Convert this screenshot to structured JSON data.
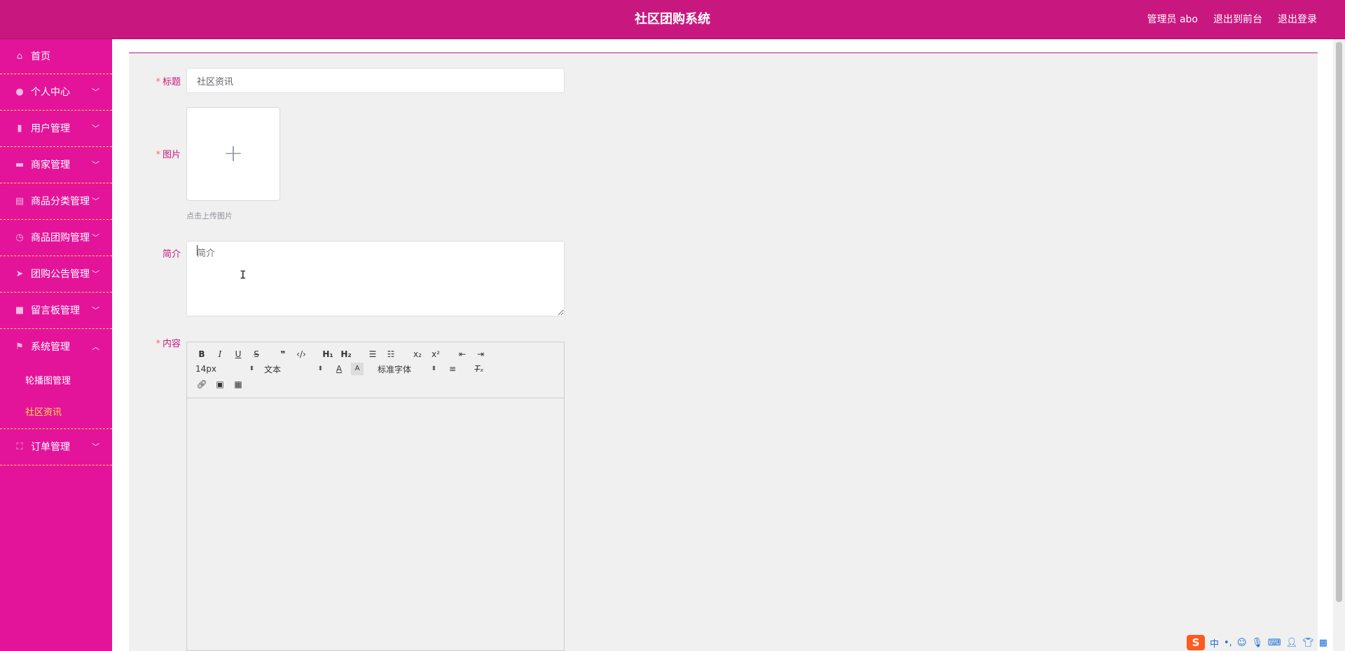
{
  "header": {
    "title": "社区团购系统",
    "user_role": "管理员",
    "username": "abo",
    "front_link": "退出到前台",
    "logout_link": "退出登录"
  },
  "sidebar": {
    "items": [
      {
        "label": "首页"
      },
      {
        "label": "个人中心"
      },
      {
        "label": "用户管理"
      },
      {
        "label": "商家管理"
      },
      {
        "label": "商品分类管理"
      },
      {
        "label": "商品团购管理"
      },
      {
        "label": "团购公告管理"
      },
      {
        "label": "留言板管理"
      },
      {
        "label": "系统管理",
        "children": [
          {
            "label": "轮播图管理"
          },
          {
            "label": "社区资讯",
            "active": true
          }
        ]
      },
      {
        "label": "订单管理"
      }
    ]
  },
  "form": {
    "title_label": "标题",
    "title_value": "社区资讯",
    "image_label": "图片",
    "upload_hint": "点击上传图片",
    "intro_label": "简介",
    "intro_placeholder": "简介",
    "content_label": "内容"
  },
  "editor": {
    "font_size": "14px",
    "text_type": "文本",
    "font_family": "标准字体"
  },
  "ime": {
    "mode": "中"
  },
  "colors": {
    "header_bg": "#c8187f",
    "sidebar_bg": "#e4149a",
    "active_sub": "#ffe14a",
    "label": "#c8187f"
  }
}
